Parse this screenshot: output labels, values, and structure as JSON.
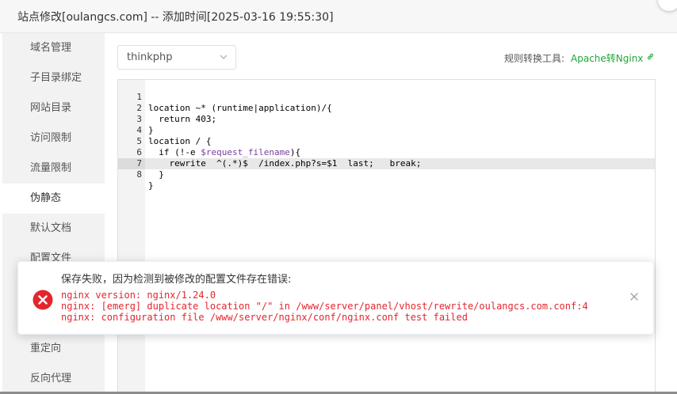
{
  "dialog": {
    "title": "站点修改[oulangcs.com] -- 添加时间[2025-03-16 19:55:30]"
  },
  "sidebar": {
    "items": [
      {
        "label": "域名管理"
      },
      {
        "label": "子目录绑定"
      },
      {
        "label": "网站目录"
      },
      {
        "label": "访问限制"
      },
      {
        "label": "流量限制"
      },
      {
        "label": "伪静态"
      },
      {
        "label": "默认文档"
      },
      {
        "label": "配置文件"
      },
      {
        "label": "重定向"
      },
      {
        "label": "反向代理"
      }
    ],
    "active": "伪静态"
  },
  "rewrite": {
    "template_select": "thinkphp",
    "tool_label": "规则转换工具:",
    "tool_link": "Apache转Nginx",
    "link_icon": "external-link-icon"
  },
  "editor": {
    "active_line": 8,
    "lines": [
      {
        "num": "1",
        "text": "location ~* (runtime|application)/{"
      },
      {
        "num": "2",
        "text": "  return 403;"
      },
      {
        "num": "3",
        "text": "}"
      },
      {
        "num": "4",
        "text": "location / {"
      },
      {
        "num": "5",
        "pre": "  if (!-e ",
        "var": "$request_filename",
        "post": "){"
      },
      {
        "num": "6",
        "text": "    rewrite  ^(.*)$  /index.php?s=$1  last;   break;"
      },
      {
        "num": "7",
        "text": "  }"
      },
      {
        "num": "8",
        "text": "}"
      }
    ]
  },
  "error_toast": {
    "heading": "保存失败，因为检测到被修改的配置文件存在错误:",
    "lines": [
      "nginx version: nginx/1.24.0",
      "nginx: [emerg] duplicate location \"/\" in /www/server/panel/vhost/rewrite/oulangcs.com.conf:4",
      "nginx: configuration file /www/server/nginx/conf/nginx.conf test failed"
    ],
    "icon": "error-icon",
    "color": "#e3262d"
  },
  "colors": {
    "accent": "#20a53a",
    "error": "#e3262d"
  }
}
